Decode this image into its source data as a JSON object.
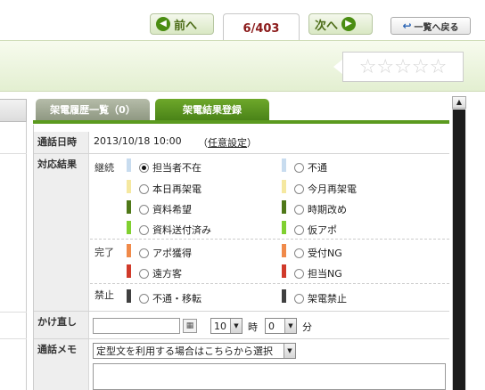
{
  "nav": {
    "prev_label": "前へ",
    "page_indicator": "6/403",
    "next_label": "次へ",
    "back_label": "一覧へ戻る"
  },
  "rating": {
    "stars_filled": 0,
    "stars_total": 5,
    "star_glyph": "☆☆☆☆☆"
  },
  "tabs": [
    {
      "label": "架電履歴一覧（0）",
      "active": false
    },
    {
      "label": "架電結果登録",
      "active": true
    }
  ],
  "form": {
    "call_datetime": {
      "label": "通話日時",
      "value": "2013/10/18 10:00",
      "link_open": "（",
      "link_text": "任意設定",
      "link_close": "）"
    },
    "result": {
      "label": "対応結果",
      "groups": [
        {
          "name": "継続",
          "options": [
            {
              "label": "担当者不在",
              "color": "#c8dcef",
              "checked": true
            },
            {
              "label": "不通",
              "color": "#c8dcef",
              "checked": false
            },
            {
              "label": "本日再架電",
              "color": "#f5e8a0",
              "checked": false
            },
            {
              "label": "今月再架電",
              "color": "#f5e8a0",
              "checked": false
            },
            {
              "label": "資料希望",
              "color": "#4f7818",
              "checked": false
            },
            {
              "label": "時期改め",
              "color": "#4f7818",
              "checked": false
            },
            {
              "label": "資料送付済み",
              "color": "#80d030",
              "checked": false
            },
            {
              "label": "仮アポ",
              "color": "#80d030",
              "checked": false
            }
          ]
        },
        {
          "name": "完了",
          "options": [
            {
              "label": "アポ獲得",
              "color": "#f08a4a",
              "checked": false
            },
            {
              "label": "受付NG",
              "color": "#f08a4a",
              "checked": false
            },
            {
              "label": "遠方客",
              "color": "#d03a2a",
              "checked": false
            },
            {
              "label": "担当NG",
              "color": "#d03a2a",
              "checked": false
            }
          ]
        },
        {
          "name": "禁止",
          "options": [
            {
              "label": "不通・移転",
              "color": "#404040",
              "checked": false
            },
            {
              "label": "架電禁止",
              "color": "#404040",
              "checked": false
            }
          ]
        }
      ]
    },
    "callback": {
      "label": "かけ直し",
      "date_value": "",
      "hour_value": "10",
      "hour_unit": "時",
      "minute_value": "0",
      "minute_unit": "分"
    },
    "memo": {
      "label": "通話メモ",
      "template_select": "定型文を利用する場合はこちらから選択",
      "text": ""
    }
  }
}
